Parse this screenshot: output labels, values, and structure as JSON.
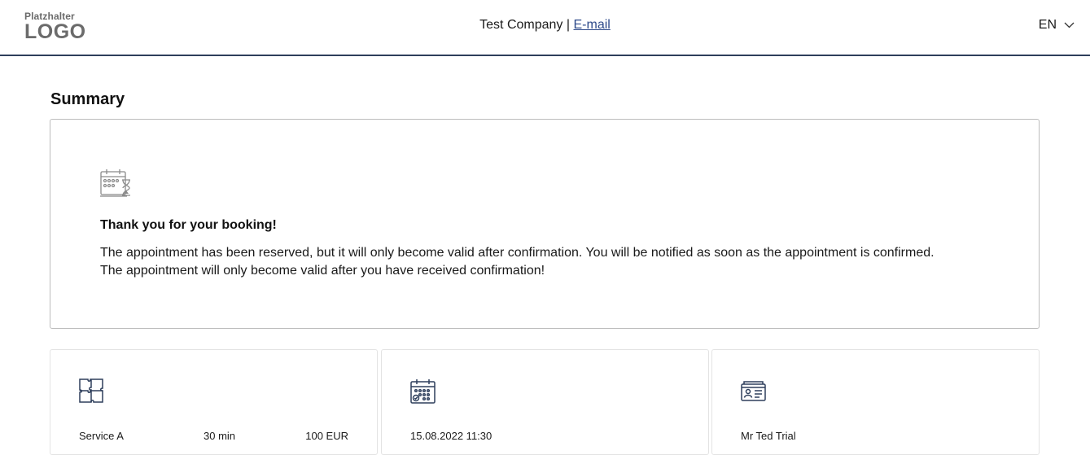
{
  "header": {
    "logo_top": "Platzhalter",
    "logo_bottom": "LOGO",
    "company_name": "Test Company",
    "separator": "|",
    "email_link": "E-mail",
    "language": "EN"
  },
  "page": {
    "title": "Summary"
  },
  "summary": {
    "icon": "calendar-hourglass-icon",
    "heading": "Thank you for your booking!",
    "message_line1": "The appointment has been reserved, but it will only become valid after confirmation. You will be notified as soon as the appointment is confirmed.",
    "message_line2": "The appointment will only become valid after you have received confirmation!"
  },
  "details": {
    "service": {
      "icon": "puzzle-icon",
      "name": "Service A",
      "duration": "30 min",
      "price": "100 EUR"
    },
    "datetime": {
      "icon": "calendar-icon",
      "value": "15.08.2022 11:30"
    },
    "customer": {
      "icon": "id-card-icon",
      "name": "Mr Ted Trial"
    }
  },
  "colors": {
    "accent": "#2e3f5c",
    "link": "#2e4a8a",
    "icon_gray": "#8a8a8a",
    "icon_navy": "#2e3f5c"
  }
}
